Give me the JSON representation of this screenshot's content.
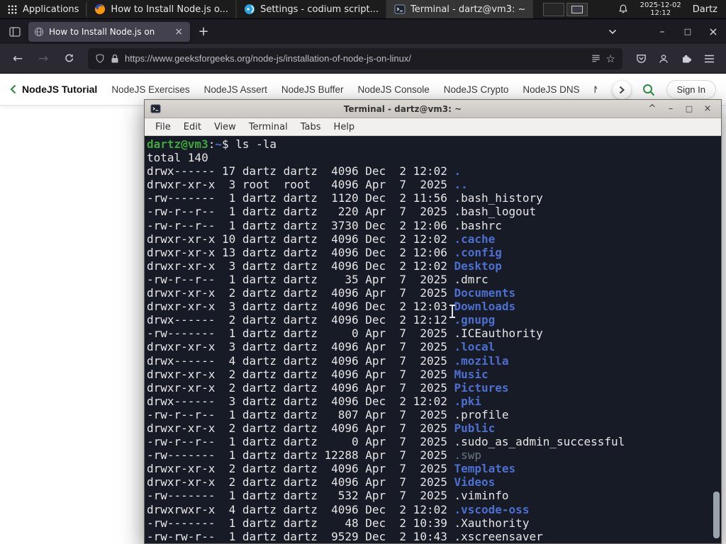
{
  "system_bar": {
    "applications_label": "Applications",
    "tasks": [
      {
        "label": "How to Install Node.js o..."
      },
      {
        "label": "Settings - codium script..."
      },
      {
        "label": "Terminal - dartz@vm3: ~"
      }
    ],
    "clock": {
      "date": "2025-12-02",
      "time": "12:12"
    },
    "user_label": "Dartz"
  },
  "browser": {
    "tab": {
      "title": "How to Install Node.js on"
    },
    "url": "https://www.geeksforgeeks.org/node-js/installation-of-node-js-on-linux/",
    "icons": {
      "back": "←",
      "forward": "→",
      "new_tab": "+",
      "tab_close": "×",
      "minimize": "–",
      "maximize": "□",
      "close": "×",
      "star": "☆"
    }
  },
  "site_nav": {
    "primary_label": "NodeJS Tutorial",
    "links": [
      "NodeJS Exercises",
      "NodeJS Assert",
      "NodeJS Buffer",
      "NodeJS Console",
      "NodeJS Crypto",
      "NodeJS DNS",
      "Node"
    ],
    "sign_in_label": "Sign In"
  },
  "terminal": {
    "window_title": "Terminal - dartz@vm3: ~",
    "menu": [
      "File",
      "Edit",
      "View",
      "Terminal",
      "Tabs",
      "Help"
    ],
    "window_buttons": {
      "shade": "^",
      "minimize": "–",
      "maximize": "□",
      "close": "×"
    },
    "prompt": {
      "user_host": "dartz@vm3",
      "colon": ":",
      "path": "~",
      "dollar": "$ "
    },
    "command": "ls -la",
    "total_line": "total 140",
    "listing": [
      {
        "perms": "drwx------",
        "links": "17",
        "owner": "dartz",
        "group": "dartz",
        "size": "4096",
        "month": "Dec",
        "day": "2",
        "time": "12:02",
        "name": ".",
        "type": "dir"
      },
      {
        "perms": "drwxr-xr-x",
        "links": "3",
        "owner": "root",
        "group": "root",
        "size": "4096",
        "month": "Apr",
        "day": "7",
        "time": "2025",
        "name": "..",
        "type": "dir"
      },
      {
        "perms": "-rw-------",
        "links": "1",
        "owner": "dartz",
        "group": "dartz",
        "size": "1120",
        "month": "Dec",
        "day": "2",
        "time": "11:56",
        "name": ".bash_history",
        "type": "file"
      },
      {
        "perms": "-rw-r--r--",
        "links": "1",
        "owner": "dartz",
        "group": "dartz",
        "size": "220",
        "month": "Apr",
        "day": "7",
        "time": "2025",
        "name": ".bash_logout",
        "type": "file"
      },
      {
        "perms": "-rw-r--r--",
        "links": "1",
        "owner": "dartz",
        "group": "dartz",
        "size": "3730",
        "month": "Dec",
        "day": "2",
        "time": "12:06",
        "name": ".bashrc",
        "type": "file"
      },
      {
        "perms": "drwxr-xr-x",
        "links": "10",
        "owner": "dartz",
        "group": "dartz",
        "size": "4096",
        "month": "Dec",
        "day": "2",
        "time": "12:02",
        "name": ".cache",
        "type": "dir"
      },
      {
        "perms": "drwxr-xr-x",
        "links": "13",
        "owner": "dartz",
        "group": "dartz",
        "size": "4096",
        "month": "Dec",
        "day": "2",
        "time": "12:06",
        "name": ".config",
        "type": "dir"
      },
      {
        "perms": "drwxr-xr-x",
        "links": "3",
        "owner": "dartz",
        "group": "dartz",
        "size": "4096",
        "month": "Dec",
        "day": "2",
        "time": "12:02",
        "name": "Desktop",
        "type": "dir"
      },
      {
        "perms": "-rw-r--r--",
        "links": "1",
        "owner": "dartz",
        "group": "dartz",
        "size": "35",
        "month": "Apr",
        "day": "7",
        "time": "2025",
        "name": ".dmrc",
        "type": "file"
      },
      {
        "perms": "drwxr-xr-x",
        "links": "2",
        "owner": "dartz",
        "group": "dartz",
        "size": "4096",
        "month": "Apr",
        "day": "7",
        "time": "2025",
        "name": "Documents",
        "type": "dir"
      },
      {
        "perms": "drwxr-xr-x",
        "links": "3",
        "owner": "dartz",
        "group": "dartz",
        "size": "4096",
        "month": "Dec",
        "day": "2",
        "time": "12:03",
        "name": "Downloads",
        "type": "dir"
      },
      {
        "perms": "drwx------",
        "links": "2",
        "owner": "dartz",
        "group": "dartz",
        "size": "4096",
        "month": "Dec",
        "day": "2",
        "time": "12:12",
        "name": ".gnupg",
        "type": "dir"
      },
      {
        "perms": "-rw-------",
        "links": "1",
        "owner": "dartz",
        "group": "dartz",
        "size": "0",
        "month": "Apr",
        "day": "7",
        "time": "2025",
        "name": ".ICEauthority",
        "type": "file"
      },
      {
        "perms": "drwxr-xr-x",
        "links": "3",
        "owner": "dartz",
        "group": "dartz",
        "size": "4096",
        "month": "Apr",
        "day": "7",
        "time": "2025",
        "name": ".local",
        "type": "dir"
      },
      {
        "perms": "drwx------",
        "links": "4",
        "owner": "dartz",
        "group": "dartz",
        "size": "4096",
        "month": "Apr",
        "day": "7",
        "time": "2025",
        "name": ".mozilla",
        "type": "dir"
      },
      {
        "perms": "drwxr-xr-x",
        "links": "2",
        "owner": "dartz",
        "group": "dartz",
        "size": "4096",
        "month": "Apr",
        "day": "7",
        "time": "2025",
        "name": "Music",
        "type": "dir"
      },
      {
        "perms": "drwxr-xr-x",
        "links": "2",
        "owner": "dartz",
        "group": "dartz",
        "size": "4096",
        "month": "Apr",
        "day": "7",
        "time": "2025",
        "name": "Pictures",
        "type": "dir"
      },
      {
        "perms": "drwx------",
        "links": "3",
        "owner": "dartz",
        "group": "dartz",
        "size": "4096",
        "month": "Dec",
        "day": "2",
        "time": "12:02",
        "name": ".pki",
        "type": "dir"
      },
      {
        "perms": "-rw-r--r--",
        "links": "1",
        "owner": "dartz",
        "group": "dartz",
        "size": "807",
        "month": "Apr",
        "day": "7",
        "time": "2025",
        "name": ".profile",
        "type": "file"
      },
      {
        "perms": "drwxr-xr-x",
        "links": "2",
        "owner": "dartz",
        "group": "dartz",
        "size": "4096",
        "month": "Apr",
        "day": "7",
        "time": "2025",
        "name": "Public",
        "type": "dir"
      },
      {
        "perms": "-rw-r--r--",
        "links": "1",
        "owner": "dartz",
        "group": "dartz",
        "size": "0",
        "month": "Apr",
        "day": "7",
        "time": "2025",
        "name": ".sudo_as_admin_successful",
        "type": "file"
      },
      {
        "perms": "-rw-------",
        "links": "1",
        "owner": "dartz",
        "group": "dartz",
        "size": "12288",
        "month": "Apr",
        "day": "7",
        "time": "2025",
        "name": ".swp",
        "type": "dim"
      },
      {
        "perms": "drwxr-xr-x",
        "links": "2",
        "owner": "dartz",
        "group": "dartz",
        "size": "4096",
        "month": "Apr",
        "day": "7",
        "time": "2025",
        "name": "Templates",
        "type": "dir"
      },
      {
        "perms": "drwxr-xr-x",
        "links": "2",
        "owner": "dartz",
        "group": "dartz",
        "size": "4096",
        "month": "Apr",
        "day": "7",
        "time": "2025",
        "name": "Videos",
        "type": "dir"
      },
      {
        "perms": "-rw-------",
        "links": "1",
        "owner": "dartz",
        "group": "dartz",
        "size": "532",
        "month": "Apr",
        "day": "7",
        "time": "2025",
        "name": ".viminfo",
        "type": "file"
      },
      {
        "perms": "drwxrwxr-x",
        "links": "4",
        "owner": "dartz",
        "group": "dartz",
        "size": "4096",
        "month": "Dec",
        "day": "2",
        "time": "12:02",
        "name": ".vscode-oss",
        "type": "dir"
      },
      {
        "perms": "-rw-------",
        "links": "1",
        "owner": "dartz",
        "group": "dartz",
        "size": "48",
        "month": "Dec",
        "day": "2",
        "time": "10:39",
        "name": ".Xauthority",
        "type": "file"
      },
      {
        "perms": "-rw-rw-r--",
        "links": "1",
        "owner": "dartz",
        "group": "dartz",
        "size": "9529",
        "month": "Dec",
        "day": "2",
        "time": "10:43",
        "name": ".xscreensaver",
        "type": "file"
      }
    ]
  },
  "colors": {
    "terminal_bg": "#161b26",
    "terminal_fg": "#e6e6e6",
    "dir_blue": "#4d6fd0",
    "prompt_green": "#3fa63f",
    "gfg_green": "#2f8d46",
    "dim_gray": "#6e7680"
  }
}
